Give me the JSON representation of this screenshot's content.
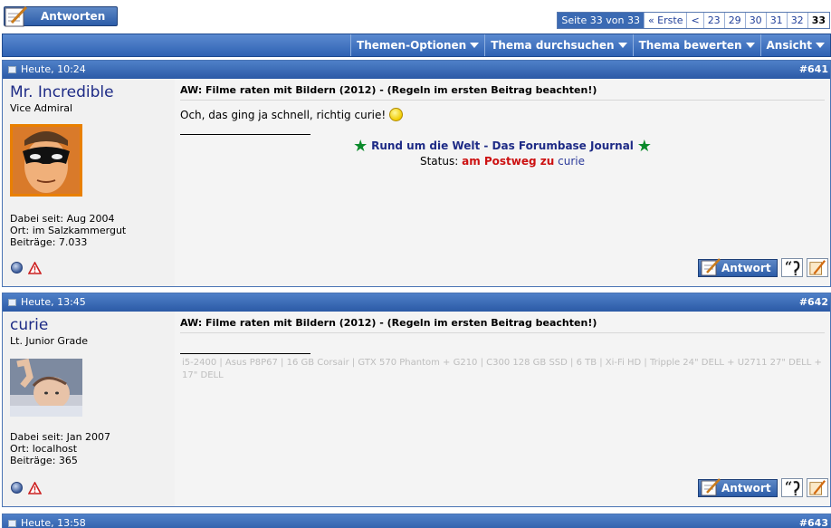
{
  "top": {
    "reply_label": "Antworten",
    "page_info": "Seite 33 von 33",
    "first_label": "« Erste",
    "prev_label": "<",
    "pages": [
      "23",
      "29",
      "30",
      "31",
      "32"
    ],
    "current_page": "33"
  },
  "toolbar": {
    "items": [
      "Themen-Optionen",
      "Thema durchsuchen",
      "Thema bewerten",
      "Ansicht"
    ]
  },
  "posts": [
    {
      "time": "Heute, 10:24",
      "number": "#641",
      "username": "Mr. Incredible",
      "rank": "Vice Admiral",
      "joined": "Dabei seit: Aug 2004",
      "location": "Ort: im Salzkammergut",
      "posts": "Beiträge: 7.033",
      "title": "AW: Filme raten mit Bildern (2012) - (Regeln im ersten Beitrag beachten!)",
      "text": "Och, das ging ja schnell, richtig curie!",
      "sig_journal": "Rund um die Welt - Das Forumbase Journal",
      "sig_status_label": "Status:",
      "sig_status_red": "am Postweg zu",
      "sig_status_user": "curie",
      "reply_button": "Antwort"
    },
    {
      "time": "Heute, 13:45",
      "number": "#642",
      "username": "curie",
      "rank": "Lt. Junior Grade",
      "joined": "Dabei seit: Jan 2007",
      "location": "Ort: localhost",
      "posts": "Beiträge: 365",
      "title": "AW: Filme raten mit Bildern (2012) - (Regeln im ersten Beitrag beachten!)",
      "signature": "i5-2400 | Asus P8P67 | 16 GB Corsair | GTX 570 Phantom + G210 | C300 128 GB SSD | 6 TB | Xi-Fi HD | Tripple 24\" DELL + U2711 27\" DELL + 17\" DELL",
      "reply_button": "Antwort"
    },
    {
      "time": "Heute, 13:58",
      "number": "#643"
    }
  ],
  "colors": {
    "header_blue": "#2f62b3",
    "username_blue": "#1e2b86",
    "status_red": "#cc1111",
    "star_green": "#0a8a2a"
  }
}
